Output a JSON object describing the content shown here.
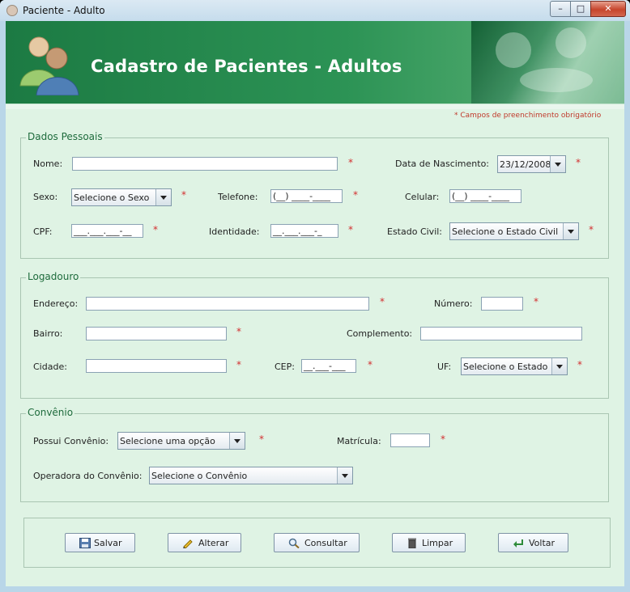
{
  "window": {
    "title": "Paciente - Adulto"
  },
  "banner": {
    "title": "Cadastro de Pacientes - Adultos"
  },
  "required_note": "*  Campos de preenchimento obrigatório",
  "asterisk": "*",
  "dados_pessoais": {
    "legend": "Dados Pessoais",
    "nome_label": "Nome:",
    "nome_value": "",
    "data_nasc_label": "Data de Nascimento:",
    "data_nasc_value": "23/12/2008",
    "sexo_label": "Sexo:",
    "sexo_value": "Selecione o Sexo",
    "telefone_label": "Telefone:",
    "telefone_value": "(__) ____-____",
    "celular_label": "Celular:",
    "celular_value": "(__) ____-____",
    "cpf_label": "CPF:",
    "cpf_value": "___.___.___-__",
    "identidade_label": "Identidade:",
    "identidade_value": "__.___.___-_",
    "estado_civil_label": "Estado Civil:",
    "estado_civil_value": "Selecione o Estado Civil"
  },
  "logradouro": {
    "legend": "Logadouro",
    "endereco_label": "Endereço:",
    "numero_label": "Número:",
    "bairro_label": "Bairro:",
    "complemento_label": "Complemento:",
    "cidade_label": "Cidade:",
    "cep_label": "CEP:",
    "cep_value": "__.___-___",
    "uf_label": "UF:",
    "uf_value": "Selecione o Estado"
  },
  "convenio": {
    "legend": "Convênio",
    "possui_label": "Possui Convênio:",
    "possui_value": "Selecione uma opção",
    "matricula_label": "Matrícula:",
    "operadora_label": "Operadora do Convênio:",
    "operadora_value": "Selecione o Convênio"
  },
  "buttons": {
    "salvar": "Salvar",
    "alterar": "Alterar",
    "consultar": "Consultar",
    "limpar": "Limpar",
    "voltar": "Voltar"
  },
  "icons": {
    "salvar": "floppy-disk-icon",
    "alterar": "pencil-icon",
    "consultar": "magnifier-icon",
    "limpar": "trash-bin-icon",
    "voltar": "return-arrow-icon",
    "banner": "patients-people-icon"
  },
  "colors": {
    "banner_green": "#2c9355",
    "panel_background": "#dff3e4",
    "required_red": "#d32f2f"
  }
}
